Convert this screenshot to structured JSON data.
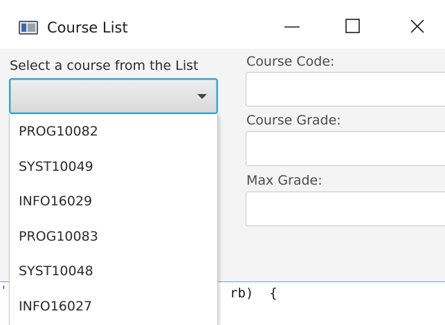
{
  "window": {
    "title": "Course List",
    "icon": "java-app-icon",
    "controls": [
      "minimize-icon",
      "maximize-icon",
      "close-icon"
    ]
  },
  "form": {
    "select_label": "Select a course from the List",
    "combo_value": "",
    "course_code_label": "Course Code:",
    "course_code_value": "",
    "course_grade_label": "Course Grade:",
    "course_grade_value": "",
    "max_grade_label": "Max Grade:",
    "max_grade_value": ""
  },
  "dropdown": {
    "items": [
      "PROG10082",
      "SYST10049",
      "INFO16029",
      "PROG10083",
      "SYST10048",
      "INFO16027"
    ]
  },
  "background": {
    "code_fragment": "rb)  {",
    "left_fragment": "'"
  },
  "colors": {
    "focus_border": "#2aa6e0",
    "window_bg": "#f4f4f4"
  }
}
